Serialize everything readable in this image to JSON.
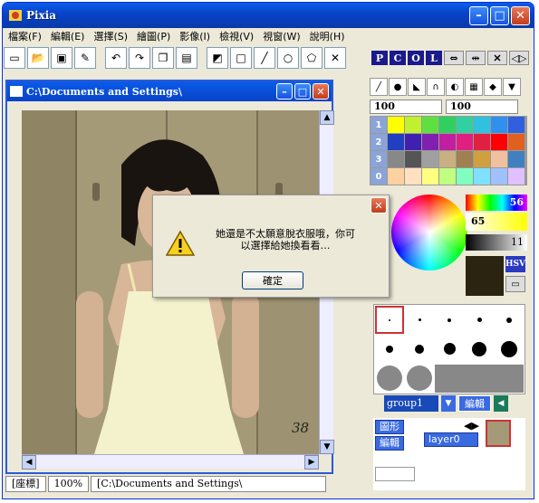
{
  "window": {
    "title": "Pixia"
  },
  "menu": [
    "檔案(F)",
    "編輯(E)",
    "選擇(S)",
    "繪圖(P)",
    "影像(I)",
    "檢視(V)",
    "視窗(W)",
    "說明(H)"
  ],
  "pcol": [
    "P",
    "C",
    "O",
    "L"
  ],
  "doc": {
    "title": "C:\\Documents and Settings\\"
  },
  "status": {
    "coord": "[座標]",
    "zoom": "100%",
    "path": "[C:\\Documents and Settings\\"
  },
  "right": {
    "val1": "100",
    "val2": "100",
    "palette_rows": [
      "1",
      "2",
      "3",
      "0"
    ],
    "slider1": "56",
    "slider2": "65",
    "slider3": "11",
    "hsv": "HSV"
  },
  "dialog": {
    "message": "她還是不太願意脫衣服哦，你可以選擇給她換看看…",
    "ok": "確定"
  },
  "layers": {
    "group": "group1",
    "edit": "編輯",
    "shape": "圖形",
    "edit2": "編輯",
    "layer": "layer0"
  },
  "photo": {
    "number": "38"
  },
  "colors": {
    "title_bar": "#0842c8",
    "close": "#c43c1c"
  }
}
